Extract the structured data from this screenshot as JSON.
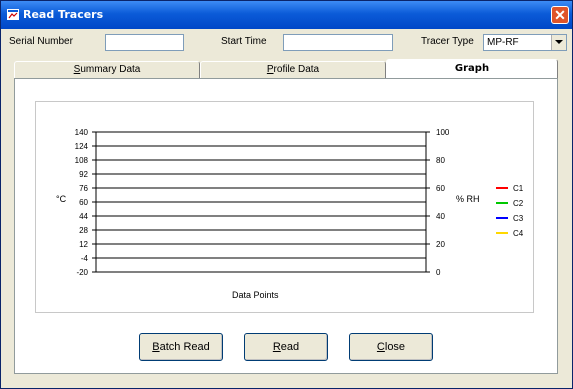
{
  "window": {
    "title": "Read Tracers",
    "close_glyph": "✕"
  },
  "header": {
    "serial_label": "Serial Number",
    "serial_value": "",
    "start_label": "Start Time",
    "start_value": "",
    "tracer_label": "Tracer Type",
    "tracer_value": "MP-RF"
  },
  "tabs": [
    {
      "label": "Summary Data",
      "underline": "S",
      "rest": "ummary Data",
      "active": false
    },
    {
      "label": "Profile Data",
      "underline": "P",
      "rest": "rofile Data",
      "active": false
    },
    {
      "label": "Graph",
      "active": true
    }
  ],
  "chart_data": {
    "type": "line",
    "xlabel": "Data Points",
    "ylabel_left": "°C",
    "ylabel_right": "% RH",
    "left_ticks": [
      140,
      124,
      108,
      92,
      76,
      60,
      44,
      28,
      12,
      -4,
      -20
    ],
    "right_ticks": [
      100,
      80,
      60,
      40,
      20,
      0
    ],
    "ylim_left": [
      -20,
      140
    ],
    "ylim_right": [
      0,
      100
    ],
    "grid": true,
    "legend_position": "right",
    "series": [
      {
        "name": "C1",
        "color": "#ff0000",
        "values": []
      },
      {
        "name": "C2",
        "color": "#00c800",
        "values": []
      },
      {
        "name": "C3",
        "color": "#0000ff",
        "values": []
      },
      {
        "name": "C4",
        "color": "#ffd800",
        "values": []
      }
    ]
  },
  "buttons": {
    "batch_read": {
      "underline": "B",
      "rest": "atch Read"
    },
    "read": {
      "underline": "R",
      "rest": "ead"
    },
    "close": {
      "underline": "C",
      "rest": "lose"
    }
  }
}
